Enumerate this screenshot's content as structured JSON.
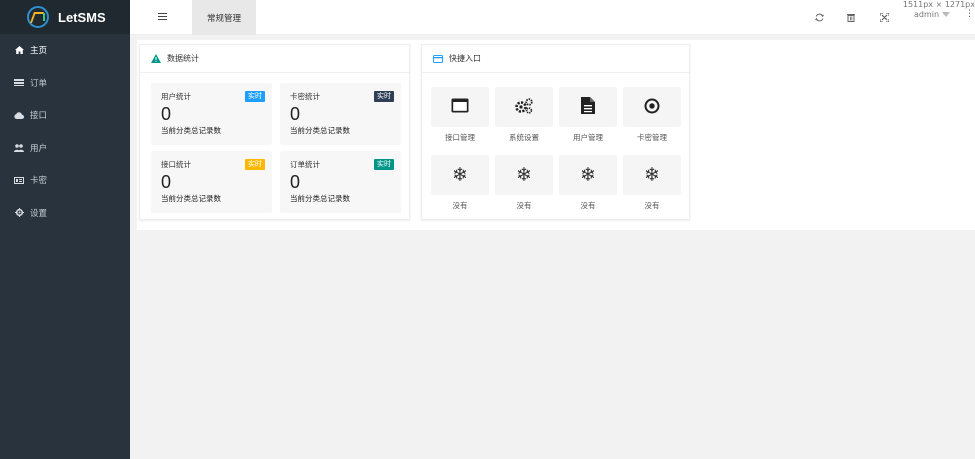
{
  "app": {
    "name": "LetSMS"
  },
  "sidebar": {
    "items": [
      {
        "label": "主页",
        "icon": "home-icon",
        "active": true
      },
      {
        "label": "订单",
        "icon": "list-icon",
        "active": false
      },
      {
        "label": "接口",
        "icon": "cloud-icon",
        "active": false
      },
      {
        "label": "用户",
        "icon": "users-icon",
        "active": false
      },
      {
        "label": "卡密",
        "icon": "card-icon",
        "active": false
      },
      {
        "label": "设置",
        "icon": "gear-icon",
        "active": false
      }
    ]
  },
  "header": {
    "tab_label": "常规管理",
    "dimension_text": "1511px × 1271px",
    "user": "admin",
    "tools": [
      "refresh-icon",
      "trash-icon",
      "fullscreen-icon"
    ]
  },
  "stats": {
    "title": "数据统计",
    "items": [
      {
        "title": "用户统计",
        "badge": "实时",
        "badge_color": "#1e9fff",
        "value": "0",
        "desc": "当前分类总记录数"
      },
      {
        "title": "卡密统计",
        "badge": "实时",
        "badge_color": "#2f4056",
        "value": "0",
        "desc": "当前分类总记录数"
      },
      {
        "title": "接口统计",
        "badge": "实时",
        "badge_color": "#ffb800",
        "value": "0",
        "desc": "当前分类总记录数"
      },
      {
        "title": "订单统计",
        "badge": "实时",
        "badge_color": "#009688",
        "value": "0",
        "desc": "当前分类总记录数"
      }
    ]
  },
  "quick": {
    "title": "快捷入口",
    "items": [
      {
        "label": "接口管理",
        "icon": "window-icon"
      },
      {
        "label": "系统设置",
        "icon": "cogs-icon"
      },
      {
        "label": "用户管理",
        "icon": "document-icon"
      },
      {
        "label": "卡密管理",
        "icon": "target-icon"
      },
      {
        "label": "没有",
        "icon": "snowflake-icon"
      },
      {
        "label": "没有",
        "icon": "snowflake-icon"
      },
      {
        "label": "没有",
        "icon": "snowflake-icon"
      },
      {
        "label": "没有",
        "icon": "snowflake-icon"
      }
    ]
  },
  "colors": {
    "sidebar_bg": "#28333e",
    "logo_bg": "#20292f",
    "warning_icon": "#009688",
    "quick_icon": "#1e9fff"
  }
}
